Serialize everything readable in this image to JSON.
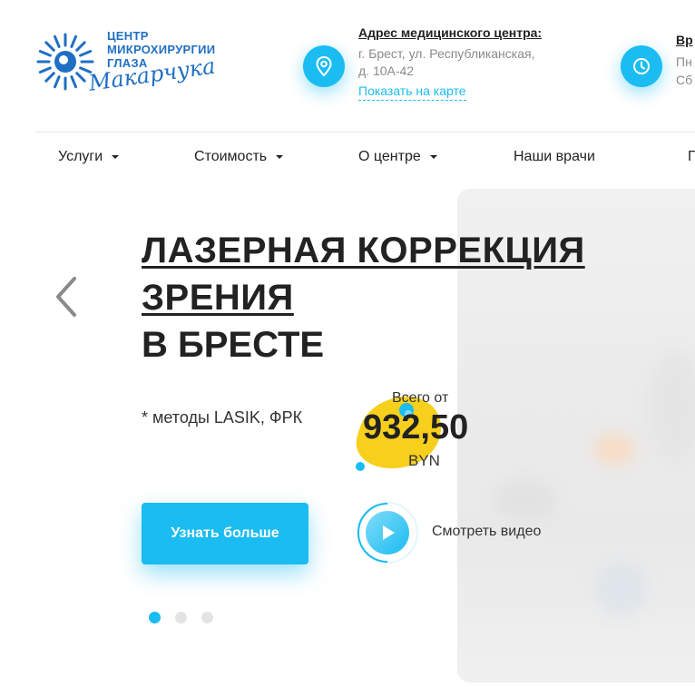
{
  "header": {
    "logo_line1": "ЦЕНТР",
    "logo_line2": "МИКРОХИРУРГИИ",
    "logo_line3": "ГЛАЗА",
    "logo_script": "Макарчука",
    "address": {
      "title": "Адрес медицинского центра:",
      "line1": "г. Брест, ул. Республиканская,",
      "line2": "д. 10А-42",
      "map_link": "Показать на карте"
    },
    "hours": {
      "title": "Вр",
      "line1": "Пн",
      "line2": "Сб"
    }
  },
  "nav": {
    "items": [
      {
        "label": "Услуги",
        "dropdown": true
      },
      {
        "label": "Стоимость",
        "dropdown": true
      },
      {
        "label": "О центре",
        "dropdown": true
      },
      {
        "label": "Наши врачи",
        "dropdown": false
      },
      {
        "label": "Г",
        "dropdown": false
      }
    ]
  },
  "hero": {
    "title_line1": "ЛАЗЕРНАЯ КОРРЕКЦИЯ",
    "title_line2": "ЗРЕНИЯ",
    "subtitle": "В БРЕСТЕ",
    "methods": "* методы LASIK, ФРК",
    "price": {
      "prefix": "Всего от",
      "value": "932,50",
      "currency": "BYN"
    },
    "cta_label": "Узнать больше",
    "video_label": "Смотреть видео",
    "slides_total": 3,
    "slide_active": 1
  },
  "colors": {
    "accent": "#1bbcf2",
    "brand_blue": "#1f6fc4",
    "price_blob": "#f7cf1d",
    "text": "#222222",
    "muted": "#8a8a8a"
  },
  "icons": {
    "location": "map-pin-icon",
    "clock": "clock-icon",
    "prev": "chevron-left-icon",
    "play": "play-icon",
    "dropdown": "caret-down-icon"
  }
}
